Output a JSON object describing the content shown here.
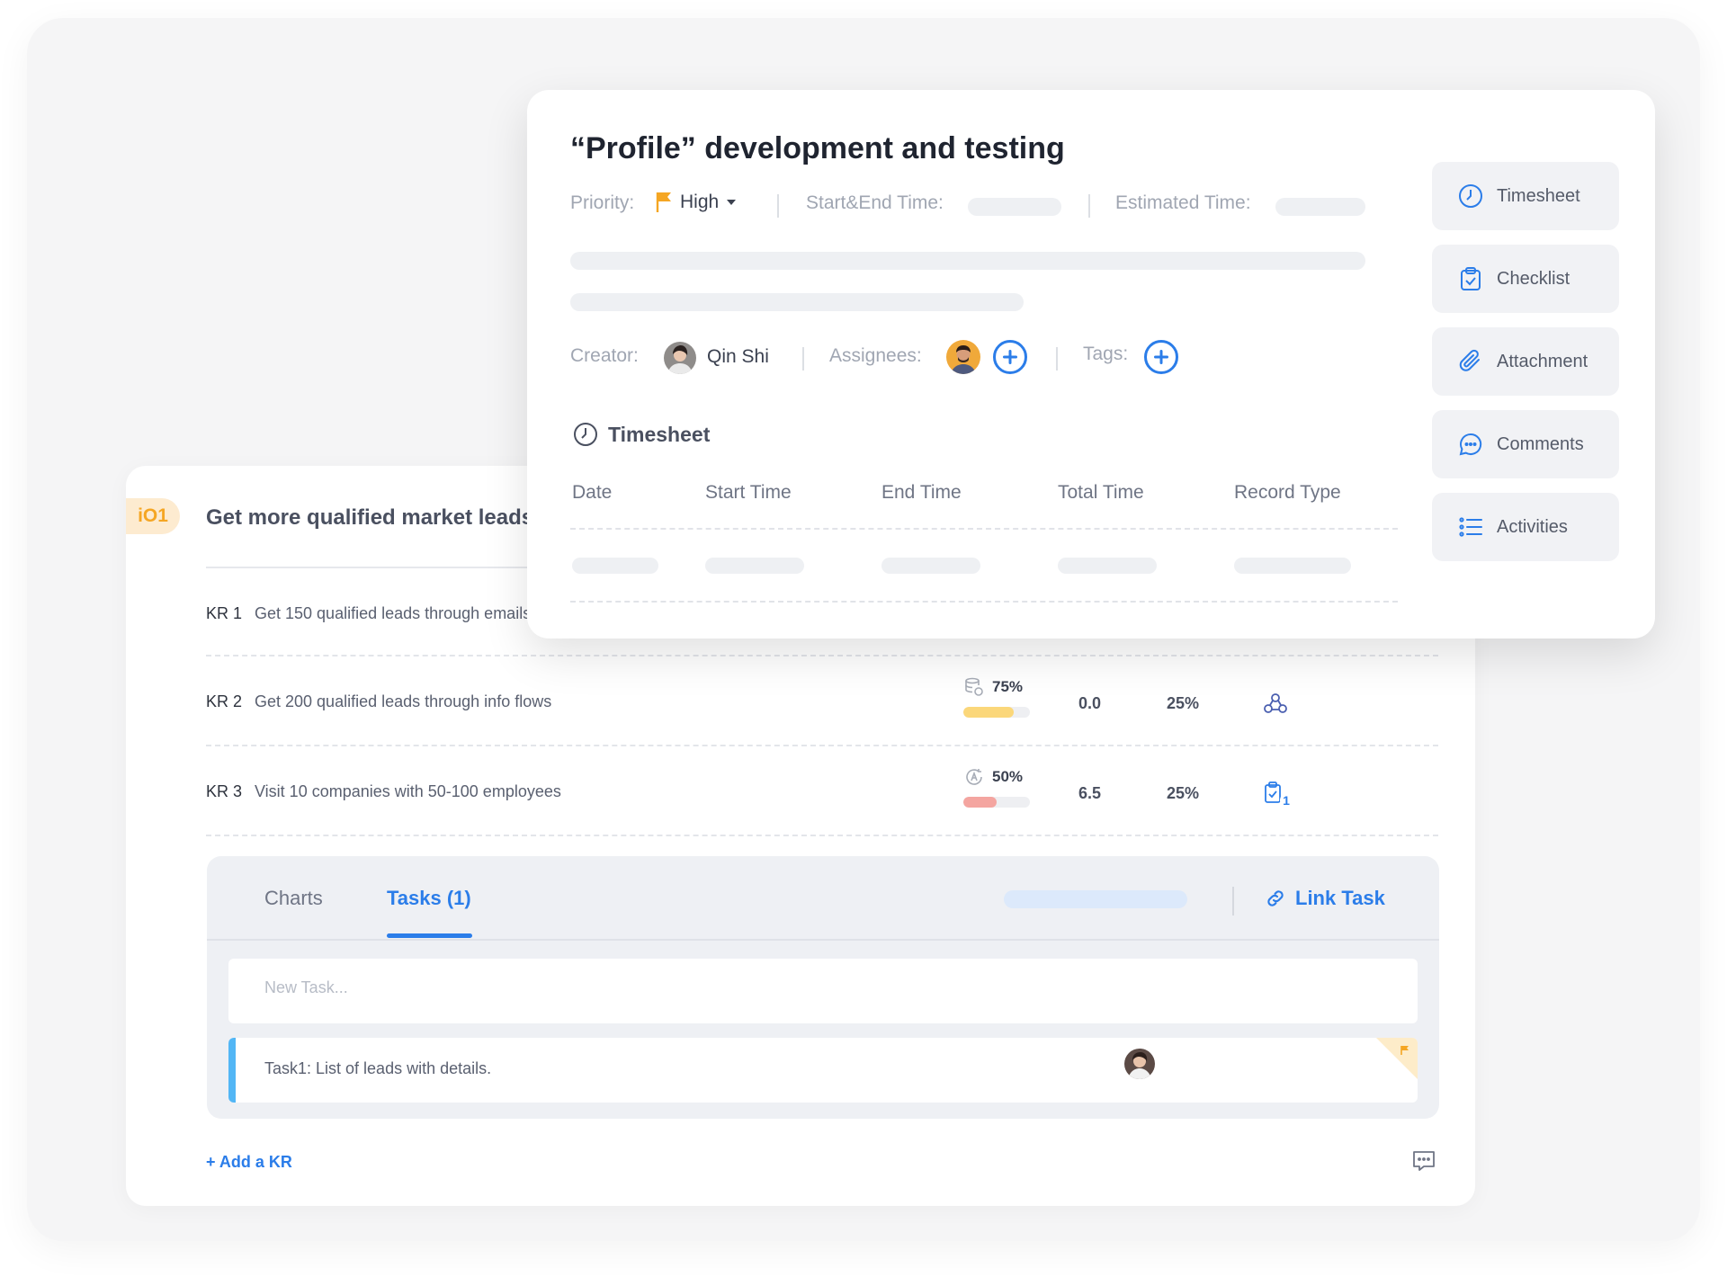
{
  "okr": {
    "objective_badge": "iO1",
    "objective_title": "Get more qualified market leads",
    "key_results": [
      {
        "label": "KR 1",
        "text": "Get 150 qualified leads through emails"
      },
      {
        "label": "KR 2",
        "text": "Get 200 qualified leads through info flows",
        "progress": "75%",
        "progress_value": 75,
        "progress_color": "#fbd77a",
        "score": "0.0",
        "weight": "25%",
        "icon": "team-icon"
      },
      {
        "label": "KR 3",
        "text": "Visit 10 companies with 50-100 employees",
        "progress": "50%",
        "progress_value": 50,
        "progress_color": "#f4a5a0",
        "score": "6.5",
        "weight": "25%",
        "icon": "checklist-badge-icon",
        "badge_count": "1"
      }
    ],
    "tabs": [
      {
        "label": "Charts",
        "active": false
      },
      {
        "label": "Tasks (1)",
        "active": true
      }
    ],
    "link_task_label": "Link Task",
    "new_task_placeholder": "New Task...",
    "tasks": [
      {
        "title": "Task1: List of leads with details.",
        "flag_color": "#f5a623",
        "accent_color": "#52b6f5"
      }
    ],
    "add_kr_label": "+ Add a KR"
  },
  "task_detail": {
    "title": "“Profile” development and testing",
    "priority_label": "Priority:",
    "priority_value": "High",
    "priority_color": "#f5a623",
    "start_end_label": "Start&End Time:",
    "estimated_label": "Estimated Time:",
    "creator_label": "Creator:",
    "creator_name": "Qin Shi",
    "assignees_label": "Assignees:",
    "tags_label": "Tags:",
    "timesheet_heading": "Timesheet",
    "timesheet_columns": [
      "Date",
      "Start Time",
      "End Time",
      "Total Time",
      "Record Type"
    ]
  },
  "side_actions": [
    {
      "label": "Timesheet",
      "icon": "clock-icon"
    },
    {
      "label": "Checklist",
      "icon": "clipboard-check-icon"
    },
    {
      "label": "Attachment",
      "icon": "paperclip-icon"
    },
    {
      "label": "Comments",
      "icon": "chat-bubble-icon"
    },
    {
      "label": "Activities",
      "icon": "list-icon"
    }
  ],
  "colors": {
    "accent": "#2b7de9",
    "flag": "#f5a623"
  }
}
